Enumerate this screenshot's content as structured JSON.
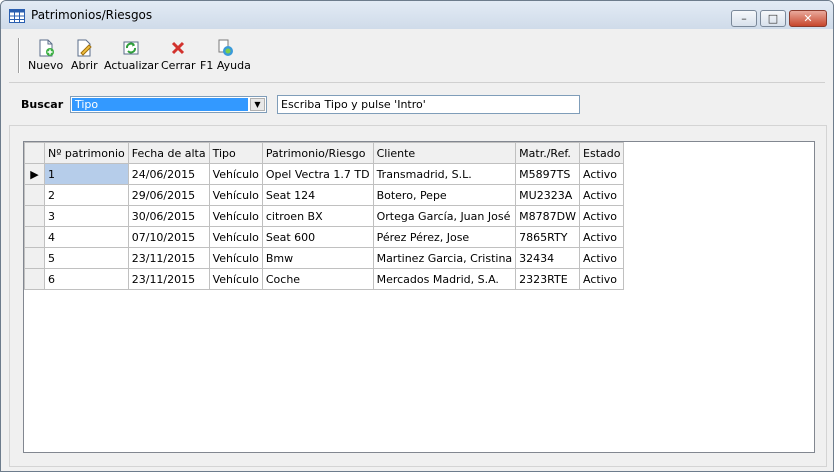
{
  "window": {
    "title": "Patrimonios/Riesgos",
    "min_glyph": "–",
    "max_glyph": "□",
    "close_glyph": "✕"
  },
  "toolbar": {
    "items": [
      {
        "label": "Nuevo",
        "icon": "new-document-icon"
      },
      {
        "label": "Abrir",
        "icon": "edit-document-icon"
      },
      {
        "label": "Actualizar",
        "icon": "refresh-icon"
      },
      {
        "label": "Cerrar",
        "icon": "close-x-icon"
      },
      {
        "label": "F1 Ayuda",
        "icon": "help-icon"
      }
    ]
  },
  "search": {
    "label": "Buscar",
    "selected": "Tipo",
    "dropdown_glyph": "▼",
    "value": "Escriba Tipo y pulse 'Intro'"
  },
  "grid": {
    "row_indicator": "▶",
    "columns": [
      "Nº patrimonio",
      "Fecha de alta",
      "Tipo",
      "Patrimonio/Riesgo",
      "Cliente",
      "Matr./Ref.",
      "Estado"
    ],
    "rows": [
      [
        "1",
        "24/06/2015",
        "Vehículo",
        "Opel Vectra 1.7 TD",
        "Transmadrid, S.L.",
        "M5897TS",
        "Activo"
      ],
      [
        "2",
        "29/06/2015",
        "Vehículo",
        "Seat 124",
        "Botero, Pepe",
        "MU2323A",
        "Activo"
      ],
      [
        "3",
        "30/06/2015",
        "Vehículo",
        "citroen BX",
        "Ortega García, Juan José",
        "M8787DW",
        "Activo"
      ],
      [
        "4",
        "07/10/2015",
        "Vehículo",
        "Seat 600",
        "Pérez Pérez, Jose",
        "7865RTY",
        "Activo"
      ],
      [
        "5",
        "23/11/2015",
        "Vehículo",
        "Bmw",
        "Martinez Garcia, Cristina",
        "32434",
        "Activo"
      ],
      [
        "6",
        "23/11/2015",
        "Vehículo",
        "Coche",
        "Mercados Madrid, S.A.",
        "2323RTE",
        "Activo"
      ]
    ]
  },
  "colors": {
    "selection": "#3399ff",
    "selected_cell": "#b6cdea",
    "close_button": "#c7462c"
  }
}
